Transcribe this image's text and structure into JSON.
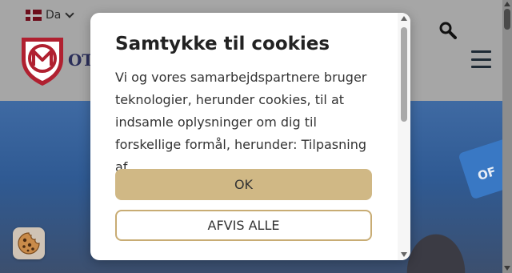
{
  "colors": {
    "accent_gold": "#d0b885",
    "reject_border": "#c8ac74",
    "brand_red": "#b02030",
    "brand_navy": "#2b2f5a"
  },
  "header": {
    "language": {
      "flag_icon": "danish-flag-icon",
      "label": "Da"
    },
    "brand_text": "OTT",
    "search_icon": "search-icon",
    "menu_icon": "hamburger-menu-icon"
  },
  "cookie_dialog": {
    "title": "Samtykke til cookies",
    "body": "Vi og vores samarbejdspartnere bruger teknologier, herunder cookies, til at indsamle oplysninger om dig til forskellige formål, herunder: Tilpasning af",
    "ok_label": "OK",
    "reject_label": "AFVIS ALLE"
  },
  "hero": {
    "sign_text": "OF"
  },
  "cookie_settings_icon": "cookie-icon"
}
